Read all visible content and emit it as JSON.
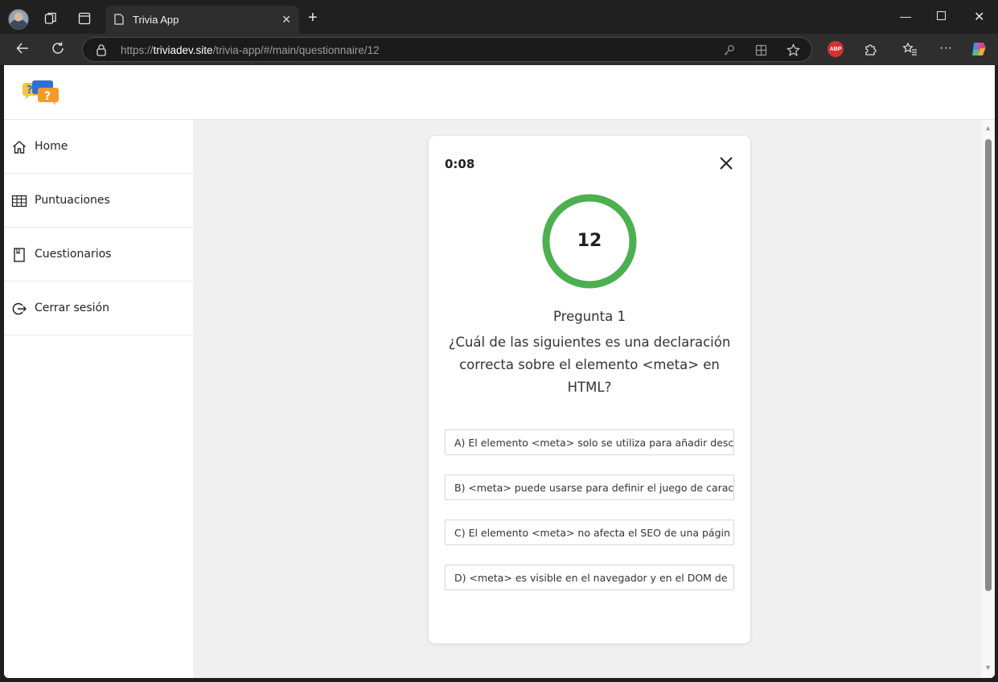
{
  "browser": {
    "tab_title": "Trivia App",
    "url_scheme": "https://",
    "url_domain": "triviadev.site",
    "url_path": "/trivia-app/#/main/questionnaire/12",
    "abp_label": "ABP"
  },
  "sidebar": {
    "items": [
      {
        "label": "Home",
        "icon": "home-icon"
      },
      {
        "label": "Puntuaciones",
        "icon": "table-icon"
      },
      {
        "label": "Cuestionarios",
        "icon": "bookmark-icon"
      },
      {
        "label": "Cerrar sesión",
        "icon": "logout-icon"
      }
    ]
  },
  "quiz": {
    "timer": "0:08",
    "countdown": "12",
    "question_number": "Pregunta 1",
    "question_text": "¿Cuál de las siguientes es una declaración correcta sobre el elemento <meta> en HTML?",
    "options": [
      "A) El elemento <meta> solo se utiliza para añadir desc",
      "B) <meta> puede usarse para definir el juego de carac",
      "C) El elemento <meta> no afecta el SEO de una págin",
      "D) <meta> es visible en el navegador y en el DOM de"
    ]
  },
  "colors": {
    "ring": "#4caf50",
    "logo_blue": "#2f6fd6",
    "logo_orange": "#f39a2a",
    "logo_yellow": "#f5c242"
  }
}
